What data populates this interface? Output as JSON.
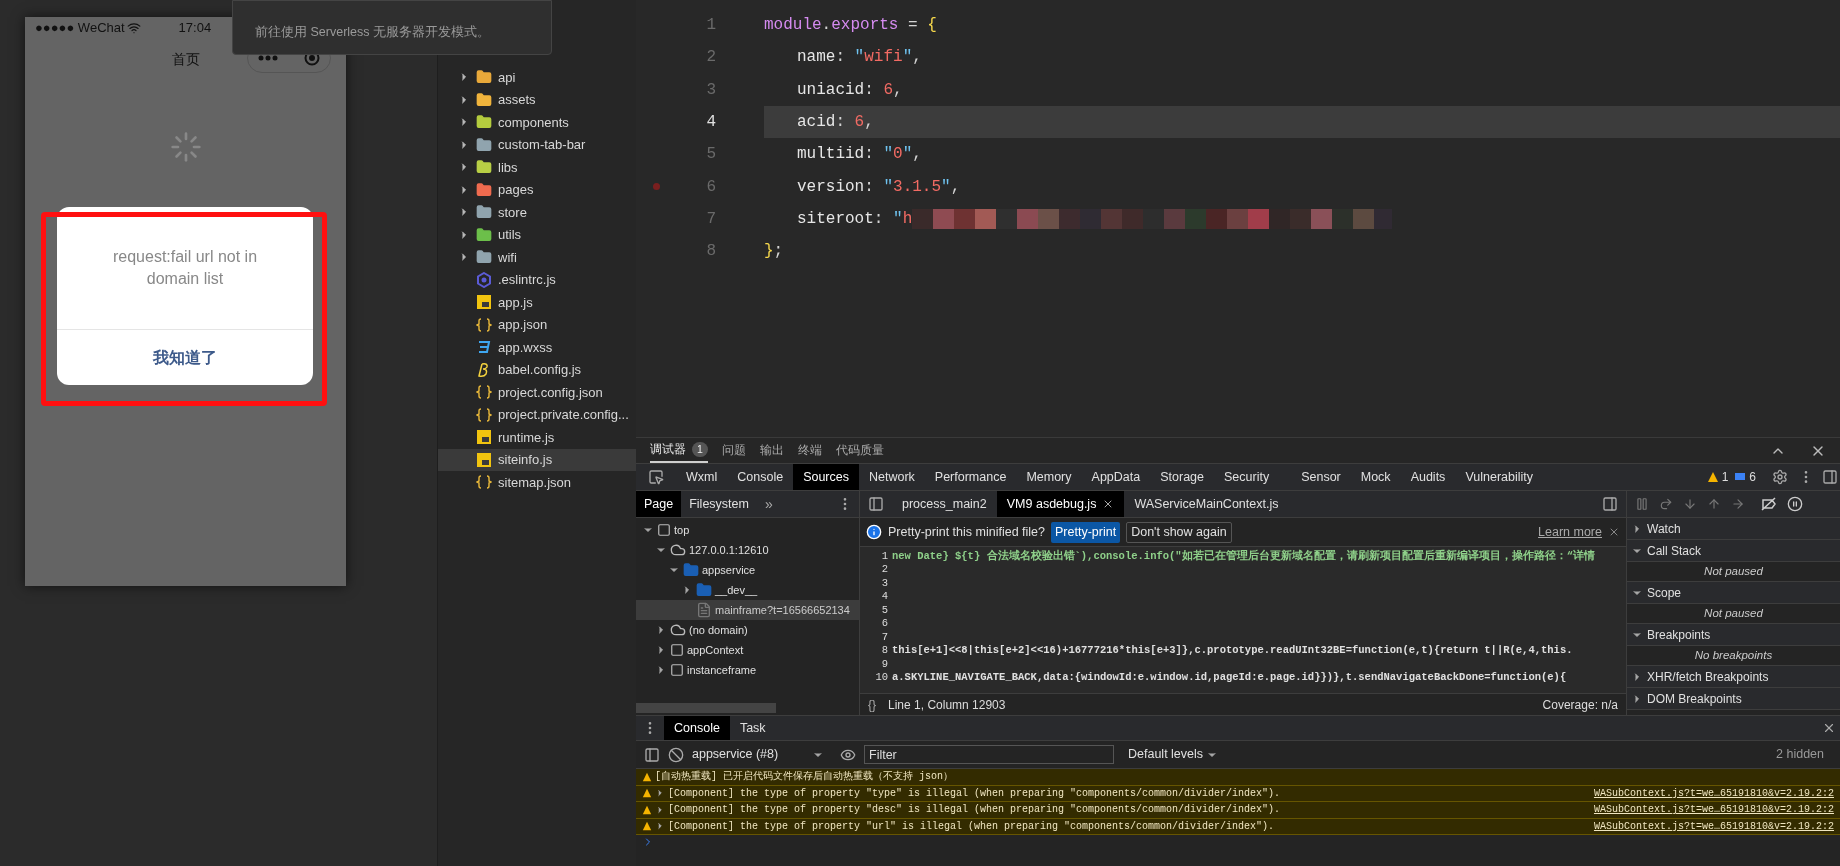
{
  "simulator": {
    "carrier": "●●●●● WeChat",
    "time": "17:04",
    "nav_title": "首页",
    "dialog": {
      "message": "request:fail url not in domain list",
      "button": "我知道了"
    }
  },
  "tooltip": {
    "text": "前往使用 Serverless 无服务器开发模式。"
  },
  "file_tree": [
    {
      "name": "api",
      "kind": "folder",
      "color": "#e9a93a",
      "selected": false
    },
    {
      "name": "assets",
      "kind": "folder",
      "color": "#f0b43c",
      "selected": false
    },
    {
      "name": "components",
      "kind": "folder",
      "color": "#b4cc3e",
      "selected": false
    },
    {
      "name": "custom-tab-bar",
      "kind": "folder",
      "color": "#90a4ae",
      "selected": false
    },
    {
      "name": "libs",
      "kind": "folder",
      "color": "#b8cf45",
      "selected": false
    },
    {
      "name": "pages",
      "kind": "folder",
      "color": "#ef6b4f",
      "selected": false
    },
    {
      "name": "store",
      "kind": "folder",
      "color": "#90a4ae",
      "selected": false
    },
    {
      "name": "utils",
      "kind": "folder",
      "color": "#6cbf4a",
      "selected": false
    },
    {
      "name": "wifi",
      "kind": "folder",
      "color": "#90a4ae",
      "selected": false
    },
    {
      "name": ".eslintrc.js",
      "kind": "eslint",
      "selected": false
    },
    {
      "name": "app.js",
      "kind": "js",
      "selected": false
    },
    {
      "name": "app.json",
      "kind": "json",
      "selected": false
    },
    {
      "name": "app.wxss",
      "kind": "css",
      "selected": false
    },
    {
      "name": "babel.config.js",
      "kind": "babel",
      "selected": false
    },
    {
      "name": "project.config.json",
      "kind": "json",
      "selected": false
    },
    {
      "name": "project.private.config...",
      "kind": "json",
      "selected": false
    },
    {
      "name": "runtime.js",
      "kind": "js",
      "selected": false
    },
    {
      "name": "siteinfo.js",
      "kind": "js",
      "selected": true
    },
    {
      "name": "sitemap.json",
      "kind": "json",
      "selected": false
    }
  ],
  "editor": {
    "lines": [
      {
        "number": "1",
        "selected": false,
        "breakpoint": false,
        "tokens": [
          {
            "kind": "keyword",
            "text": "module"
          },
          {
            "kind": "punct",
            "text": "."
          },
          {
            "kind": "keyword",
            "text": "exports"
          },
          {
            "kind": "punct",
            "text": " = "
          },
          {
            "kind": "brace",
            "text": "{"
          }
        ]
      },
      {
        "number": "2",
        "selected": false,
        "breakpoint": false,
        "tokens": [
          {
            "kind": "prop",
            "text": "name"
          },
          {
            "kind": "punct",
            "text": ": "
          },
          {
            "kind": "quote",
            "text": "\""
          },
          {
            "kind": "string",
            "text": "wifi"
          },
          {
            "kind": "quote",
            "text": "\""
          },
          {
            "kind": "punct",
            "text": ","
          }
        ]
      },
      {
        "number": "3",
        "selected": false,
        "breakpoint": false,
        "tokens": [
          {
            "kind": "prop",
            "text": "uniacid"
          },
          {
            "kind": "punct",
            "text": ": "
          },
          {
            "kind": "number",
            "text": "6"
          },
          {
            "kind": "punct",
            "text": ","
          }
        ]
      },
      {
        "number": "4",
        "selected": true,
        "breakpoint": false,
        "tokens": [
          {
            "kind": "prop",
            "text": "acid"
          },
          {
            "kind": "punct",
            "text": ": "
          },
          {
            "kind": "number",
            "text": "6"
          },
          {
            "kind": "punct",
            "text": ","
          }
        ]
      },
      {
        "number": "5",
        "selected": false,
        "breakpoint": false,
        "tokens": [
          {
            "kind": "prop",
            "text": "multiid"
          },
          {
            "kind": "punct",
            "text": ": "
          },
          {
            "kind": "quote",
            "text": "\""
          },
          {
            "kind": "string",
            "text": "0"
          },
          {
            "kind": "quote",
            "text": "\""
          },
          {
            "kind": "punct",
            "text": ","
          }
        ]
      },
      {
        "number": "6",
        "selected": false,
        "breakpoint": true,
        "tokens": [
          {
            "kind": "prop",
            "text": "version"
          },
          {
            "kind": "punct",
            "text": ": "
          },
          {
            "kind": "quote",
            "text": "\""
          },
          {
            "kind": "string",
            "text": "3.1.5"
          },
          {
            "kind": "quote",
            "text": "\""
          },
          {
            "kind": "punct",
            "text": ","
          }
        ]
      },
      {
        "number": "7",
        "selected": false,
        "breakpoint": false,
        "redacted": true,
        "tokens": [
          {
            "kind": "prop",
            "text": "siteroot"
          },
          {
            "kind": "punct",
            "text": ": "
          },
          {
            "kind": "quote",
            "text": "\""
          },
          {
            "kind": "string",
            "text": "h"
          }
        ]
      },
      {
        "number": "8",
        "selected": false,
        "breakpoint": false,
        "tokens": [
          {
            "kind": "brace",
            "text": "}"
          },
          {
            "kind": "punct",
            "text": ";"
          }
        ]
      }
    ]
  },
  "devtools": {
    "top_tabs": [
      {
        "label": "调试器",
        "badge": "1",
        "selected": true
      },
      {
        "label": "问题",
        "selected": false
      },
      {
        "label": "输出",
        "selected": false
      },
      {
        "label": "终端",
        "selected": false
      },
      {
        "label": "代码质量",
        "selected": false
      }
    ],
    "panel_tabs": [
      {
        "label": "Wxml",
        "selected": false
      },
      {
        "label": "Console",
        "selected": false
      },
      {
        "label": "Sources",
        "selected": true
      },
      {
        "label": "Network",
        "selected": false
      },
      {
        "label": "Performance",
        "selected": false
      },
      {
        "label": "Memory",
        "selected": false
      },
      {
        "label": "AppData",
        "selected": false
      },
      {
        "label": "Storage",
        "selected": false
      },
      {
        "label": "Security",
        "selected": false
      },
      {
        "label": "Sensor",
        "selected": false
      },
      {
        "label": "Mock",
        "selected": false
      },
      {
        "label": "Audits",
        "selected": false
      },
      {
        "label": "Vulnerability",
        "selected": false
      }
    ],
    "warning_count": "1",
    "message_count": "6",
    "navigator_tabs": [
      {
        "label": "Page",
        "selected": true
      },
      {
        "label": "Filesystem",
        "selected": false
      }
    ],
    "navigator_more": "»",
    "tree": [
      {
        "label": "top",
        "kind": "frame",
        "expanded": true,
        "selected": false,
        "children": [
          {
            "label": "127.0.0.1:12610",
            "kind": "cloud",
            "expanded": true,
            "selected": false,
            "children": [
              {
                "label": "appservice",
                "kind": "folder",
                "expanded": true,
                "selected": false,
                "children": [
                  {
                    "label": "__dev__",
                    "kind": "folder",
                    "expanded": false,
                    "selected": false
                  },
                  {
                    "label": "mainframe?t=16566652134",
                    "kind": "file",
                    "selected": true
                  }
                ]
              }
            ]
          },
          {
            "label": "(no domain)",
            "kind": "cloud",
            "expanded": false,
            "selected": false
          },
          {
            "label": "appContext",
            "kind": "frame",
            "expanded": false,
            "selected": false
          },
          {
            "label": "instanceframe",
            "kind": "frame",
            "expanded": false,
            "selected": false
          }
        ]
      }
    ],
    "file_tabs": [
      {
        "label": "process_main2",
        "selected": false,
        "closable": false
      },
      {
        "label": "VM9 asdebug.js",
        "selected": true,
        "closable": true
      },
      {
        "label": "WAServiceMainContext.js",
        "selected": false,
        "closable": false
      }
    ],
    "pretty_print": {
      "question": "Pretty-print this minified file?",
      "primary": "Pretty-print",
      "secondary": "Don't show again",
      "link": "Learn more"
    },
    "code_lines": [
      {
        "number": "1",
        "kind": "highlight",
        "text": "new Date} ${t} 合法域名校验出错`),console.info(\"如若已在管理后台更新域名配置，请刷新项目配置后重新编译项目，操作路径：“详情"
      },
      {
        "number": "2"
      },
      {
        "number": "3"
      },
      {
        "number": "4"
      },
      {
        "number": "5"
      },
      {
        "number": "6"
      },
      {
        "number": "7"
      },
      {
        "number": "8",
        "kind": "plain",
        "text": "this[e+1]<<8|this[e+2]<<16)+16777216*this[e+3]},c.prototype.readUInt32BE=function(e,t){return t||R(e,4,this."
      },
      {
        "number": "9"
      },
      {
        "number": "10",
        "kind": "plain",
        "text": "a.SKYLINE_NAVIGATE_BACK,data:{windowId:e.window.id,pageId:e.page.id}})},t.sendNavigateBackDone=function(e){"
      }
    ],
    "status": {
      "braces": "{}",
      "position": "Line 1, Column 12903",
      "coverage": "Coverage: n/a"
    },
    "debugger_sections": [
      {
        "title": "Watch",
        "expanded": false
      },
      {
        "title": "Call Stack",
        "expanded": true,
        "body": "Not paused"
      },
      {
        "title": "Scope",
        "expanded": true,
        "body": "Not paused"
      },
      {
        "title": "Breakpoints",
        "expanded": true,
        "body": "No breakpoints"
      },
      {
        "title": "XHR/fetch Breakpoints",
        "expanded": false
      },
      {
        "title": "DOM Breakpoints",
        "expanded": false
      }
    ]
  },
  "console": {
    "tabs": [
      {
        "label": "Console",
        "selected": true
      },
      {
        "label": "Task",
        "selected": false
      }
    ],
    "context": "appservice (#8)",
    "filter_placeholder": "Filter",
    "levels": "Default levels",
    "hidden": "2 hidden",
    "messages": [
      {
        "text": "[自动热重载] 已开启代码文件保存后自动热重载（不支持 json）",
        "expandable": false
      },
      {
        "text": "[Component] the type of property \"type\" is illegal (when preparing \"components/common/divider/index\").",
        "expandable": true,
        "source": "WASubContext.js?t=we…65191810&v=2.19.2:2"
      },
      {
        "text": "[Component] the type of property \"desc\" is illegal (when preparing \"components/common/divider/index\").",
        "expandable": true,
        "source": "WASubContext.js?t=we…65191810&v=2.19.2:2"
      },
      {
        "text": "[Component] the type of property \"url\" is illegal (when preparing \"components/common/divider/index\").",
        "expandable": true,
        "source": "WASubContext.js?t=we…65191810&v=2.19.2:2"
      }
    ]
  }
}
